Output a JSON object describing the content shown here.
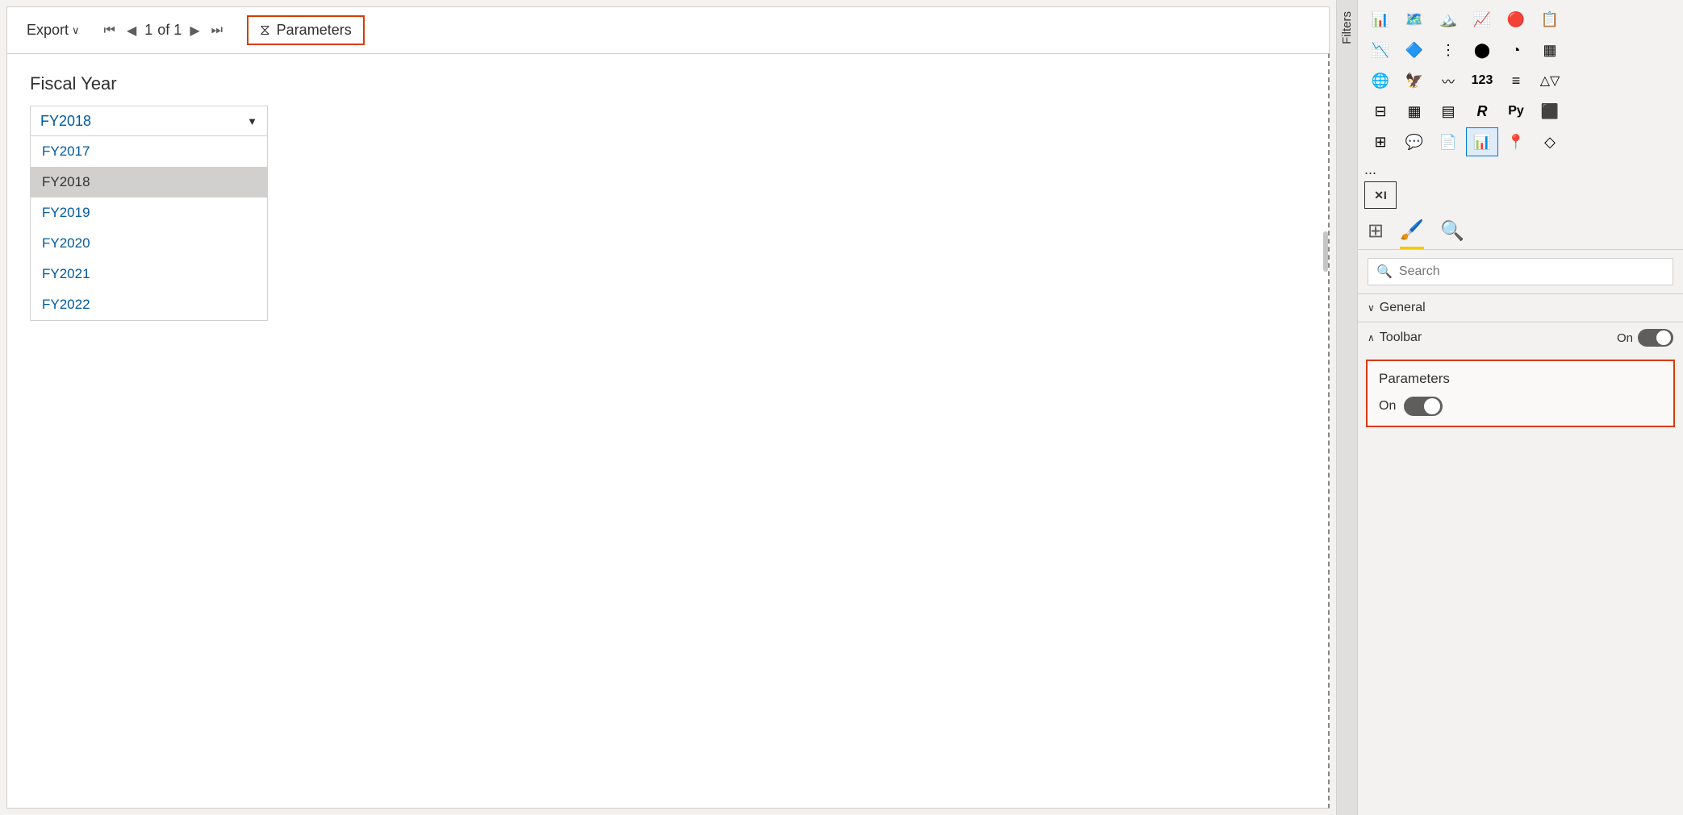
{
  "toolbar": {
    "export_label": "Export",
    "export_chevron": "∨",
    "page_number": "1",
    "of_label": "of 1",
    "parameters_label": "Parameters",
    "filter_icon": "⧫"
  },
  "report": {
    "fiscal_year_label": "Fiscal Year",
    "dropdown_selected": "FY2018",
    "dropdown_items": [
      {
        "value": "FY2017",
        "selected": false
      },
      {
        "value": "FY2018",
        "selected": true
      },
      {
        "value": "FY2019",
        "selected": false
      },
      {
        "value": "FY2020",
        "selected": false
      },
      {
        "value": "FY2021",
        "selected": false
      },
      {
        "value": "FY2022",
        "selected": false
      }
    ]
  },
  "right_panel": {
    "filters_label": "Filters",
    "search_placeholder": "Search",
    "general_section": "General",
    "toolbar_section": "Toolbar",
    "toolbar_toggle_label": "On",
    "parameters_section_title": "Parameters",
    "parameters_toggle_label": "On",
    "more_dots": "..."
  },
  "icons": {
    "row1": [
      "📊",
      "🗺",
      "🌄",
      "📈",
      "🔴",
      "📋"
    ],
    "row2": [
      "📉",
      "🔷",
      "⋮⋮",
      "⬤",
      "◔",
      "▦"
    ],
    "row3": [
      "🌐",
      "🦅",
      "〰",
      "123",
      "≡",
      "△▽"
    ],
    "row4": [
      "⊟",
      "▦",
      "▦",
      "R",
      "Py",
      "⬛"
    ],
    "row5": [
      "⊞",
      "💬",
      "📄",
      "📊",
      "📍",
      "◇"
    ]
  },
  "tabs": [
    {
      "id": "fields",
      "icon": "⊞"
    },
    {
      "id": "format",
      "icon": "🖌"
    },
    {
      "id": "analytics",
      "icon": "🔍"
    }
  ]
}
